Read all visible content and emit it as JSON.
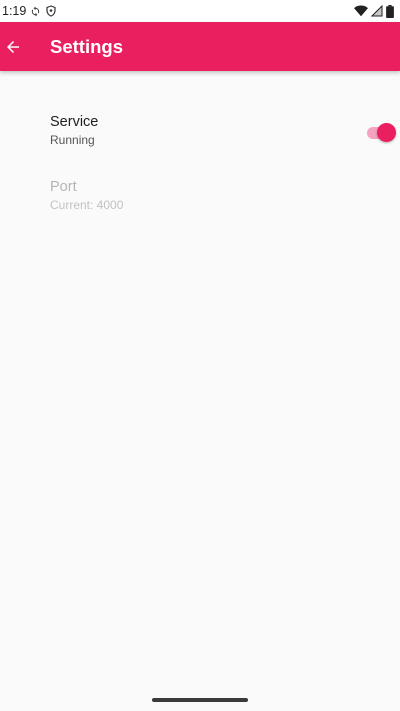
{
  "status_bar": {
    "time": "1:19",
    "left_icons": [
      "sync-icon",
      "shield-icon"
    ],
    "right_icons": [
      "wifi-icon",
      "signal-icon",
      "battery-icon"
    ]
  },
  "app_bar": {
    "title": "Settings",
    "back_icon": "arrow-back-icon",
    "background_color": "#ea1f60"
  },
  "preferences": [
    {
      "title": "Service",
      "summary": "Running",
      "enabled": true,
      "switch_on": true
    },
    {
      "title": "Port",
      "summary": "Current: 4000",
      "enabled": false
    }
  ],
  "accent_color": "#ea1f60"
}
